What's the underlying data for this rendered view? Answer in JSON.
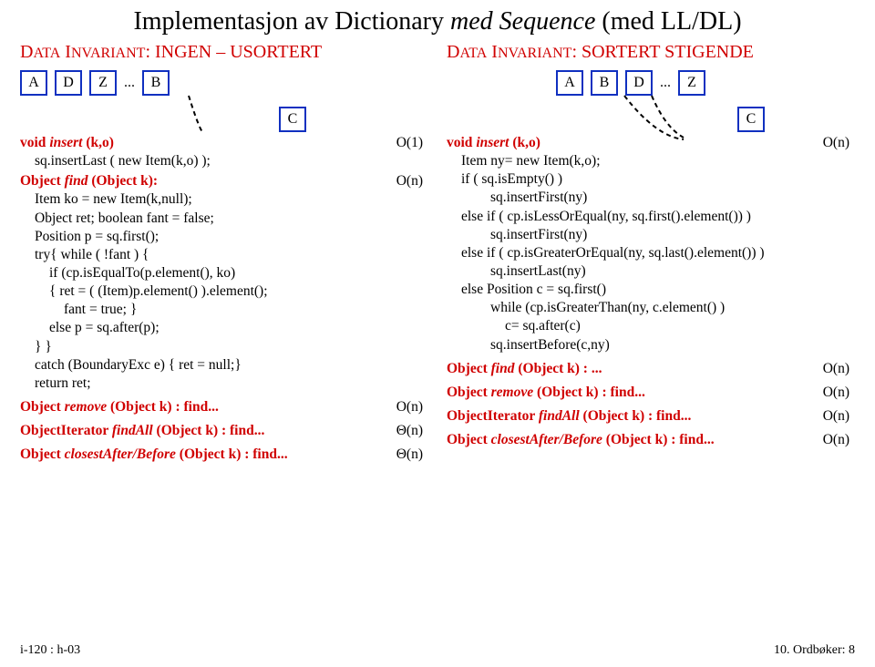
{
  "title": {
    "plain": "Implementasjon av Dictionary",
    "ital": "med Sequence",
    "paren": "(med LL/DL)"
  },
  "left": {
    "heading_pre": "D",
    "heading_word1": "ATA",
    "heading_word2": " I",
    "heading_word3": "NVARIANT",
    "heading_suffix": ": INGEN – USORTERT",
    "nodes": [
      "A",
      "D",
      "Z",
      "...",
      "B"
    ],
    "c_node": "C",
    "insert_sig": "void ",
    "insert_name": "insert",
    "insert_args": " (k,o)",
    "insert_bigo": "O(1)",
    "insert_body": "sq.insertLast ( new Item(k,o) );",
    "find_sig": "Object ",
    "find_name": "find",
    "find_args": " (Object k):",
    "find_bigo": "O(n)",
    "find_l1": "Item ko = new Item(k,null);",
    "find_l2": "Object ret; boolean fant = false;",
    "find_l3": "Position p = sq.first();",
    "find_l4": "try{ while ( !fant ) {",
    "find_l5": "if (cp.isEqualTo(p.element(), ko)",
    "find_l6": "{ ret = ( (Item)p.element() ).element();",
    "find_l7": "fant = true; }",
    "find_l8": "else p = sq.after(p);",
    "find_l9": "} }",
    "find_l10": "catch (BoundaryExc e) { ret = null;}",
    "find_l11": "return ret;",
    "remove_sig": "Object ",
    "remove_name": "remove",
    "remove_args": " (Object k) : find...",
    "remove_bigo": "O(n)",
    "findall_sig": "ObjectIterator ",
    "findall_name": "findAll",
    "findall_args": " (Object k) : find...",
    "findall_bigo": "Θ(n)",
    "closest_sig": "Object ",
    "closest_name": "closestAfter/Before",
    "closest_args": " (Object k) : find...",
    "closest_bigo": "Θ(n)"
  },
  "right": {
    "heading_pre": "D",
    "heading_word1": "ATA",
    "heading_word2": " I",
    "heading_word3": "NVARIANT",
    "heading_suffix": ": SORTERT STIGENDE",
    "nodes": [
      "A",
      "B",
      "D",
      "...",
      "Z"
    ],
    "c_node": "C",
    "insert_sig": "void ",
    "insert_name": "insert",
    "insert_args": " (k,o)",
    "insert_bigo": "O(n)",
    "ins_l1": "Item ny= new Item(k,o);",
    "ins_l2": "if ( sq.isEmpty() )",
    "ins_l3": "sq.insertFirst(ny)",
    "ins_l4": "else if ( cp.isLessOrEqual(ny, sq.first().element()) )",
    "ins_l5": "sq.insertFirst(ny)",
    "ins_l6": "else if ( cp.isGreaterOrEqual(ny, sq.last().element()) )",
    "ins_l7": "sq.insertLast(ny)",
    "ins_l8": "else Position c = sq.first()",
    "ins_l9": "while (cp.isGreaterThan(ny, c.element() )",
    "ins_l10": "c= sq.after(c)",
    "ins_l11": "sq.insertBefore(c,ny)",
    "find_sig": "Object ",
    "find_name": "find",
    "find_args": " (Object k) : ...",
    "find_bigo": "O(n)",
    "remove_sig": "Object ",
    "remove_name": "remove",
    "remove_args": " (Object k) : find...",
    "remove_bigo": "O(n)",
    "findall_sig": "ObjectIterator ",
    "findall_name": "findAll",
    "findall_args": " (Object k) : find...",
    "findall_bigo": "O(n)",
    "closest_sig": "Object ",
    "closest_name": "closestAfter/Before",
    "closest_args": " (Object k) : find...",
    "closest_bigo": "O(n)"
  },
  "footer": {
    "left": "i-120 : h-03",
    "right": "10. Ordbøker:   8"
  }
}
